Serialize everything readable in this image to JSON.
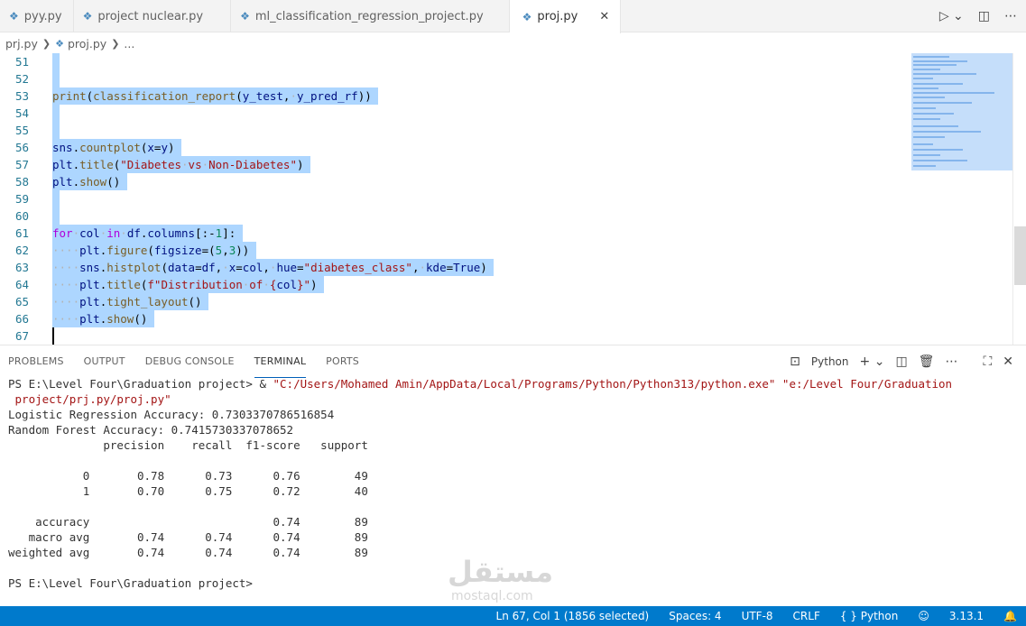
{
  "tabs": [
    {
      "label": "pyy.py"
    },
    {
      "label": "project nuclear.py"
    },
    {
      "label": "ml_classification_regression_project.py"
    },
    {
      "label": "proj.py",
      "close": "✕"
    }
  ],
  "breadcrumb": {
    "folder": "prj.py",
    "file": "proj.py",
    "more": "..."
  },
  "editor": {
    "line_numbers": [
      "51",
      "52",
      "53",
      "54",
      "55",
      "56",
      "57",
      "58",
      "59",
      "60",
      "61",
      "62",
      "63",
      "64",
      "65",
      "66",
      "67"
    ]
  },
  "panel": {
    "tabs": [
      "PROBLEMS",
      "OUTPUT",
      "DEBUG CONSOLE",
      "TERMINAL",
      "PORTS"
    ],
    "active_tab": "TERMINAL",
    "terminal_name": "Python"
  },
  "terminal": {
    "prompt1": "PS E:\\Level Four\\Graduation project> & ",
    "cmd_exe": "\"C:/Users/Mohamed Amin/AppData/Local/Programs/Python/Python313/python.exe\"",
    "cmd_arg": " \"e:/Level Four/Graduation",
    "cmd_arg2": " project/prj.py/proj.py\"",
    "out": [
      "Logistic Regression Accuracy: 0.7303370786516854",
      "Random Forest Accuracy: 0.7415730337078652",
      "              precision    recall  f1-score   support",
      "",
      "           0       0.78      0.73      0.76        49",
      "           1       0.70      0.75      0.72        40",
      "",
      "    accuracy                           0.74        89",
      "   macro avg       0.74      0.74      0.74        89",
      "weighted avg       0.74      0.74      0.74        89",
      "",
      "PS E:\\Level Four\\Graduation project> "
    ]
  },
  "statusbar": {
    "position": "Ln 67, Col 1 (1856 selected)",
    "spaces": "Spaces: 4",
    "encoding": "UTF-8",
    "eol": "CRLF",
    "language": "{ } Python",
    "version": "3.13.1"
  },
  "watermark": {
    "arabic": "مستقل",
    "latin": "mostaql.com"
  },
  "colors": {
    "selection": "#add6ff",
    "statusbar": "#007acc",
    "line_number": "#237893"
  }
}
